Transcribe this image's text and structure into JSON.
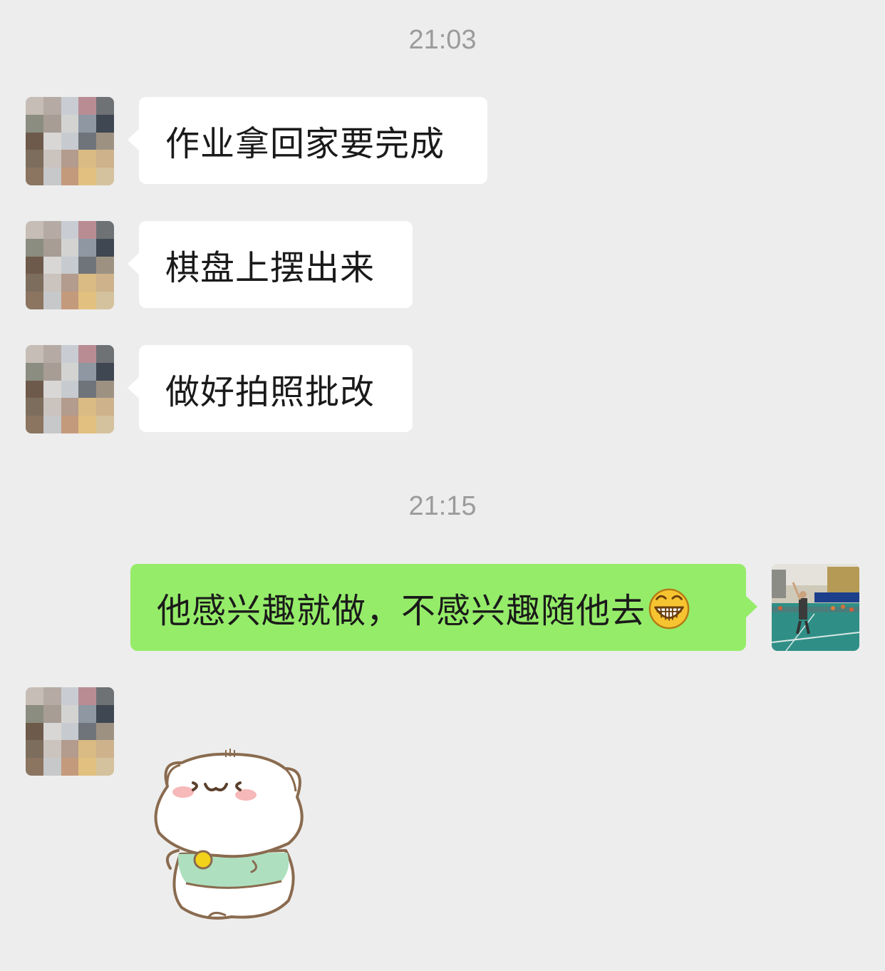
{
  "chat": {
    "timestamps": [
      "21:03",
      "21:15"
    ],
    "messages": [
      {
        "from": "other",
        "text": "作业拿回家要完成"
      },
      {
        "from": "other",
        "text": "棋盘上摆出来"
      },
      {
        "from": "other",
        "text": "做好拍照批改"
      },
      {
        "from": "me",
        "text": "他感兴趣就做，不感兴趣随他去",
        "emoji": "grinning-face-icon"
      },
      {
        "from": "other",
        "type": "sticker",
        "sticker": "white-cat-sticker"
      }
    ]
  },
  "colors": {
    "background": "#ededed",
    "incoming_bubble": "#ffffff",
    "outgoing_bubble": "#95ec69",
    "timestamp_text": "#9b9b9b"
  }
}
